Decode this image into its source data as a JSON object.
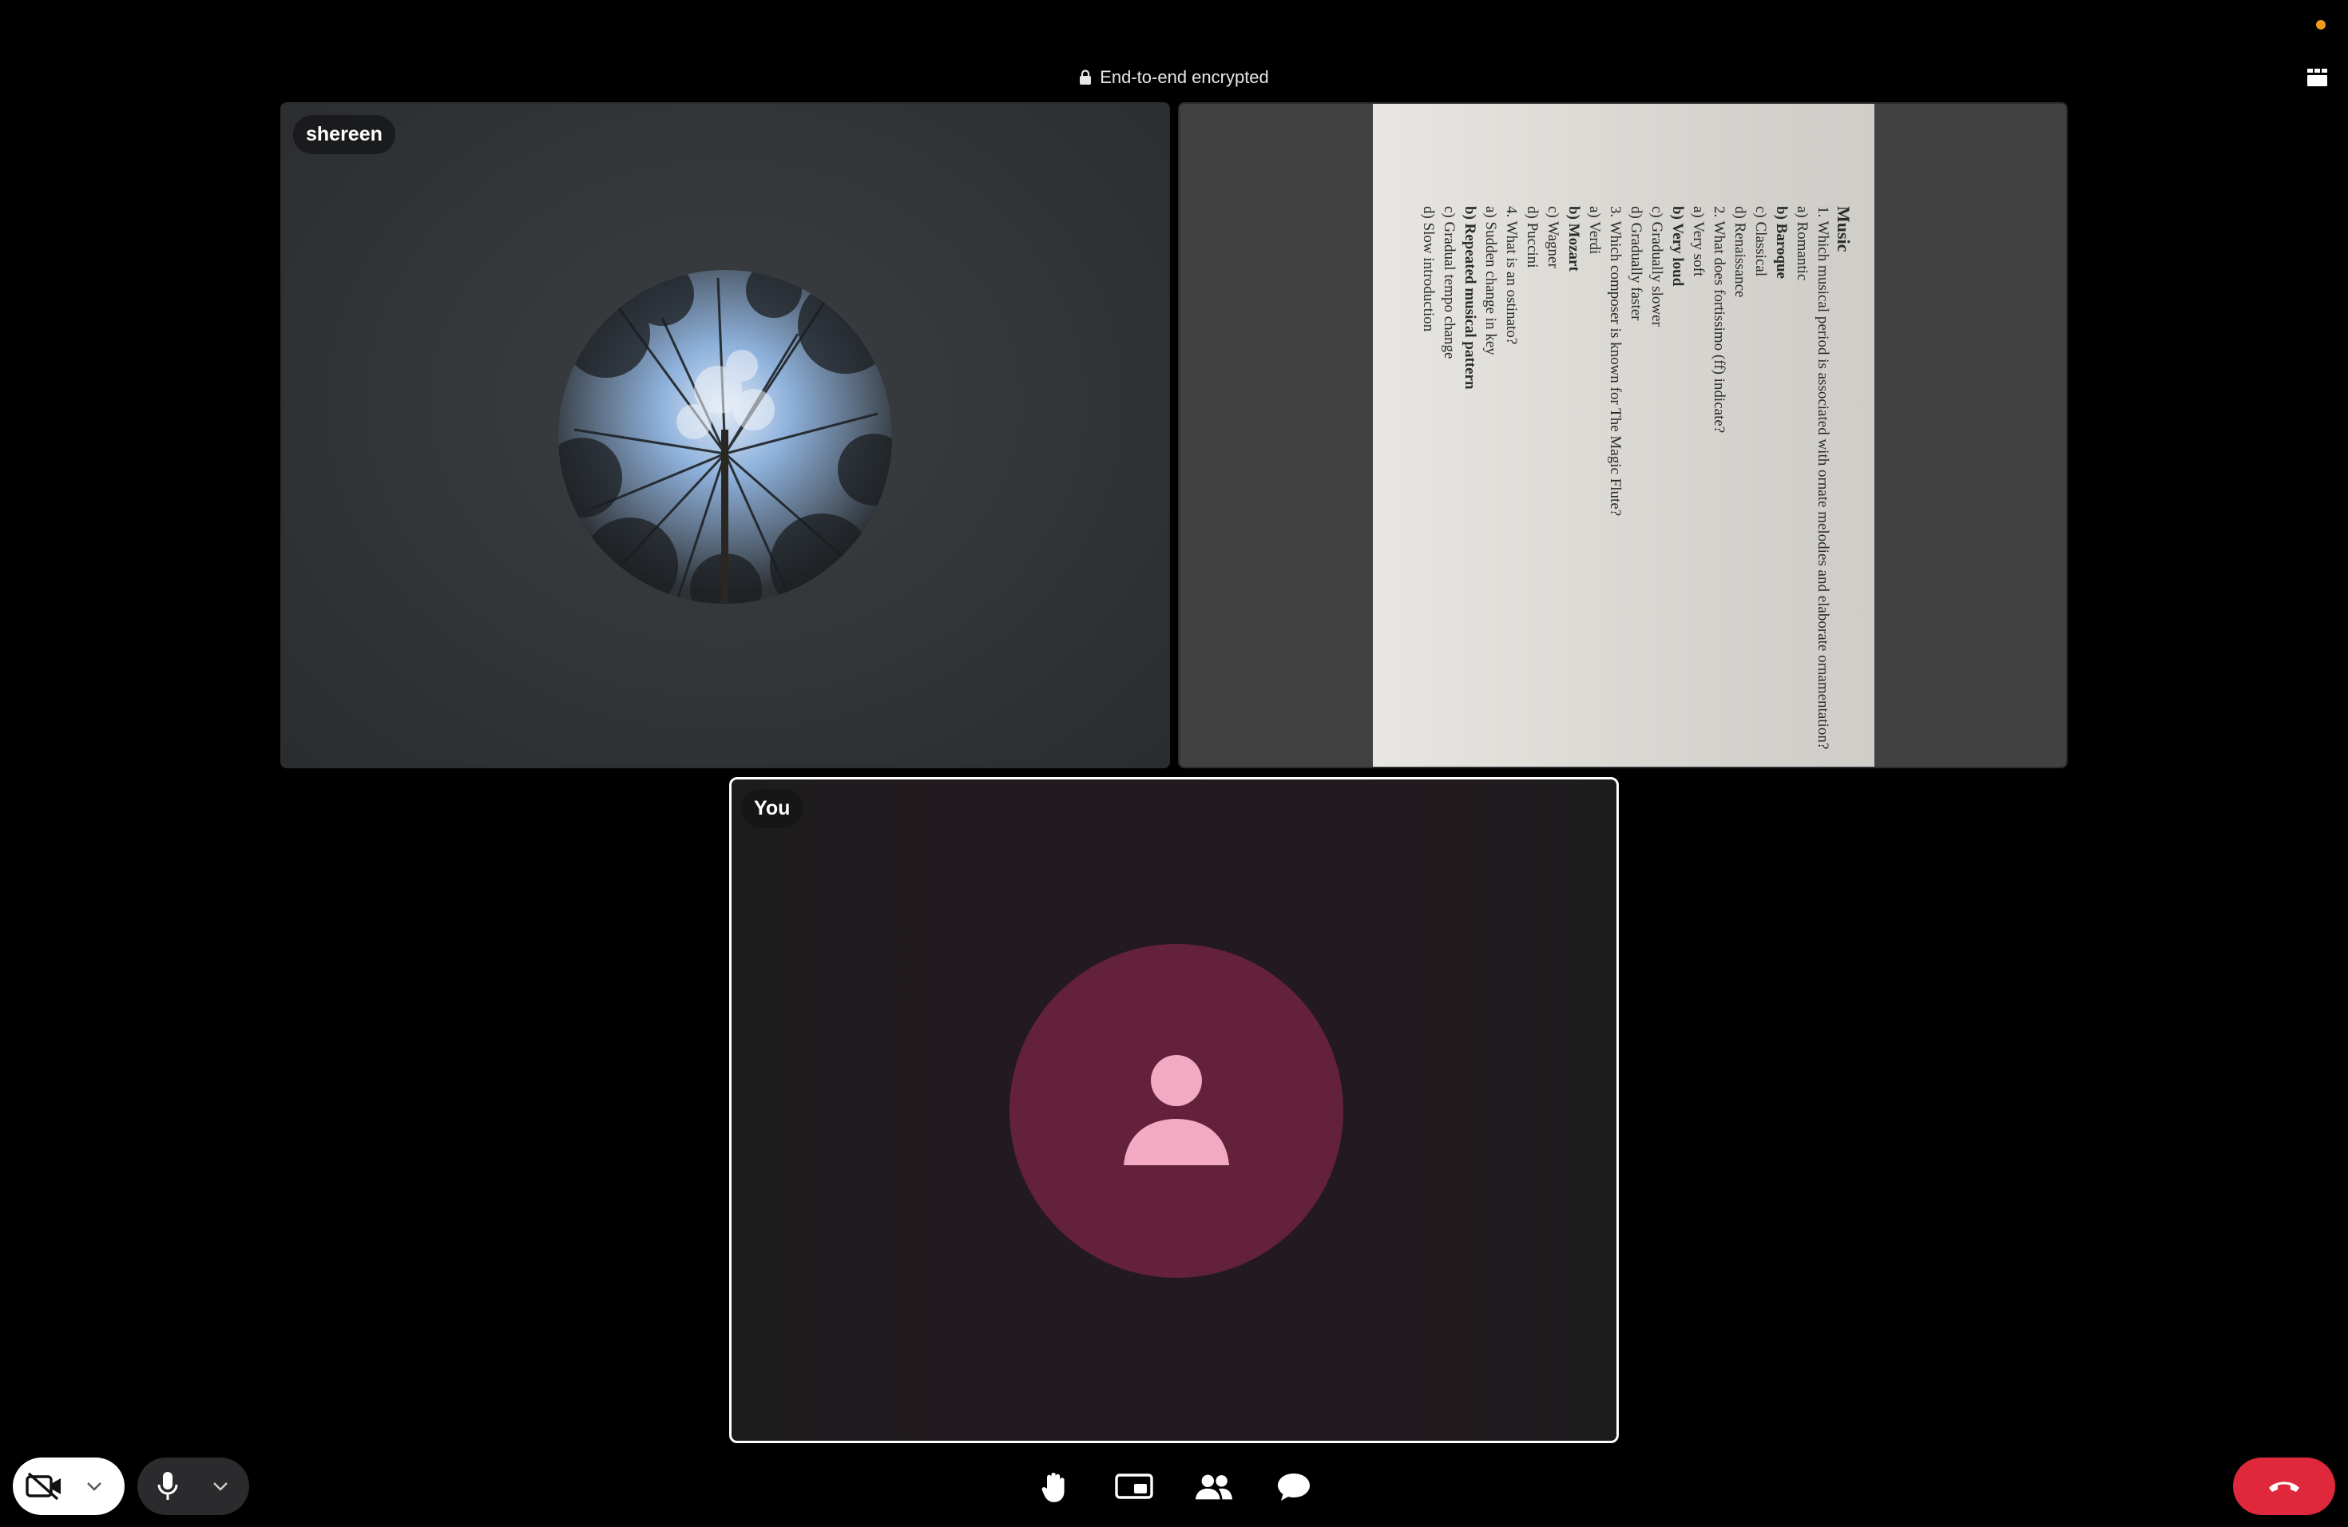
{
  "header": {
    "encryption_label": "End-to-end encrypted",
    "grid_icon": "grid-view-icon",
    "status_dot_color": "#f19a1c"
  },
  "participants": [
    {
      "name": "shereen",
      "media": "camera-video"
    },
    {
      "name": "",
      "media": "screen-share"
    },
    {
      "name": "You",
      "media": "avatar",
      "avatar_color": "#64213b",
      "avatar_icon": "person-icon"
    }
  ],
  "shared_document": {
    "heading": "Music",
    "lines": [
      "1.  Which musical period is associated with ornate melodies and elaborate ornamentation?",
      "a) Romantic",
      "b) Baroque",
      "c) Classical",
      "d) Renaissance",
      "2.  What does fortissimo (ff) indicate?",
      "a) Very soft",
      "b) Very loud",
      "c) Gradually slower",
      "d) Gradually faster",
      "3.  Which composer is known for The Magic Flute?",
      "a) Verdi",
      "b) Mozart",
      "c) Wagner",
      "d) Puccini",
      "4.  What is an ostinato?",
      "a) Sudden change in key",
      "b) Repeated musical pattern",
      "c) Gradual tempo change",
      "d) Slow introduction"
    ]
  },
  "controls": {
    "camera_icon": "camera-off-icon",
    "camera_menu_icon": "chevron-down-icon",
    "mic_icon": "microphone-icon",
    "mic_menu_icon": "chevron-down-icon",
    "raise_hand_icon": "raise-hand-icon",
    "share_screen_icon": "share-screen-icon",
    "participants_icon": "participants-icon",
    "chat_icon": "chat-icon",
    "end_call_icon": "end-call-icon",
    "end_call_color": "#e0283c"
  }
}
